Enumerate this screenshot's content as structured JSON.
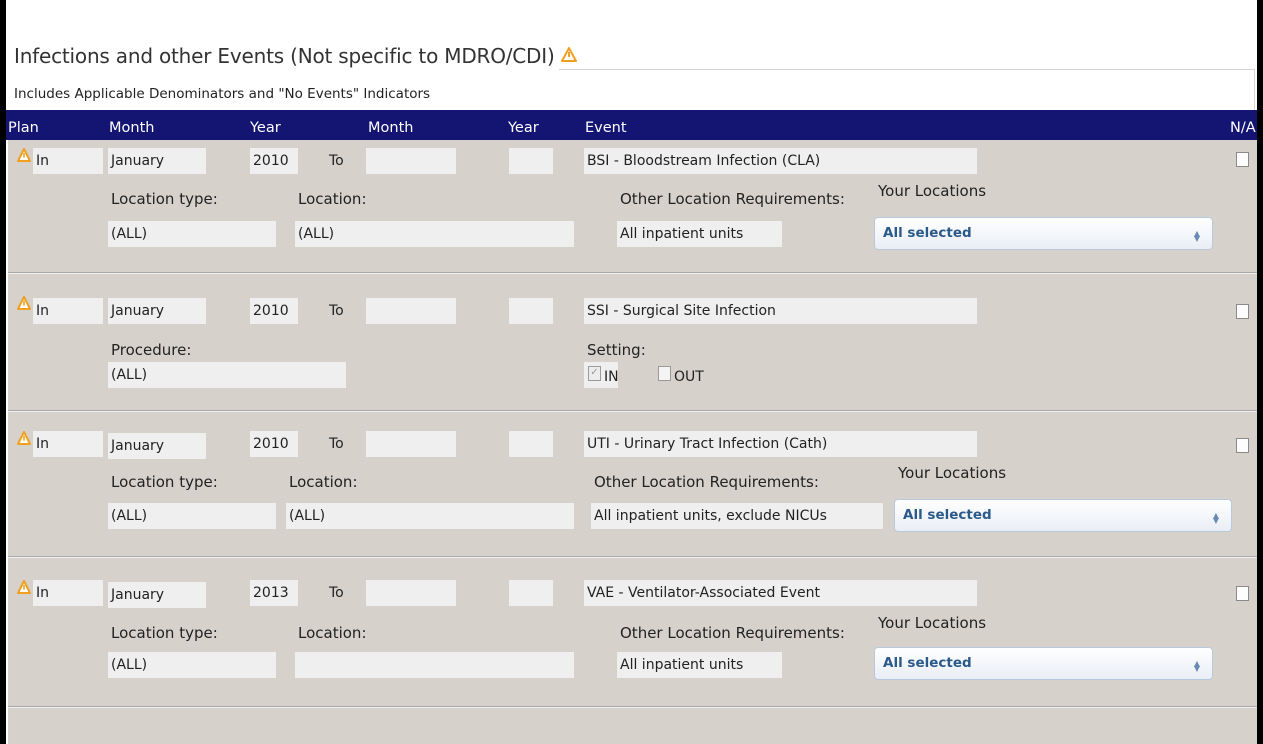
{
  "section": {
    "title": "Infections and other Events (Not specific to MDRO/CDI)",
    "subtitle": "Includes Applicable Denominators and \"No Events\" Indicators"
  },
  "header": {
    "plan": "Plan",
    "month1": "Month",
    "year1": "Year",
    "month2": "Month",
    "year2": "Year",
    "event": "Event",
    "na": "N/A"
  },
  "rows": [
    {
      "plan": "In",
      "month": "January",
      "year": "2010",
      "to": "To",
      "end_month": "",
      "end_year": "",
      "event": "BSI - Bloodstream Infection (CLA)",
      "location_type_label": "Location type:",
      "location_type": "(ALL)",
      "location_label": "Location:",
      "location": "(ALL)",
      "other_req_label": "Other Location Requirements:",
      "other_req": "All inpatient units",
      "your_locations_label": "Your Locations",
      "your_locations": "All selected",
      "na_checked": false
    },
    {
      "plan": "In",
      "month": "January",
      "year": "2010",
      "to": "To",
      "end_month": "",
      "end_year": "",
      "event": "SSI - Surgical Site Infection",
      "procedure_label": "Procedure:",
      "procedure": "(ALL)",
      "setting_label": "Setting:",
      "setting_in": "IN",
      "setting_out": "OUT",
      "setting_in_checked": true,
      "setting_out_checked": false,
      "na_checked": false
    },
    {
      "plan": "In",
      "month": "January",
      "year": "2010",
      "to": "To",
      "end_month": "",
      "end_year": "",
      "event": "UTI - Urinary Tract Infection (Cath)",
      "location_type_label": "Location type:",
      "location_type": "(ALL)",
      "location_label": "Location:",
      "location": "(ALL)",
      "other_req_label": "Other Location Requirements:",
      "other_req": "All inpatient units, exclude NICUs",
      "your_locations_label": "Your Locations",
      "your_locations": "All selected",
      "na_checked": false
    },
    {
      "plan": "In",
      "month": "January",
      "year": "2013",
      "to": "To",
      "end_month": "",
      "end_year": "",
      "event": "VAE - Ventilator-Associated Event",
      "location_type_label": "Location type:",
      "location_type": "(ALL)",
      "location_label": "Location:",
      "location": "",
      "other_req_label": "Other Location Requirements:",
      "other_req": "All inpatient units",
      "your_locations_label": "Your Locations",
      "your_locations": "All selected",
      "na_checked": false
    }
  ],
  "colors": {
    "header_bg": "#141473",
    "content_bg": "#d6d2cb",
    "warning": "#f0a020",
    "select_text": "#2a5a8a"
  },
  "icons": {
    "warning": "warning-icon",
    "select_arrows": "updown-arrows-icon"
  }
}
